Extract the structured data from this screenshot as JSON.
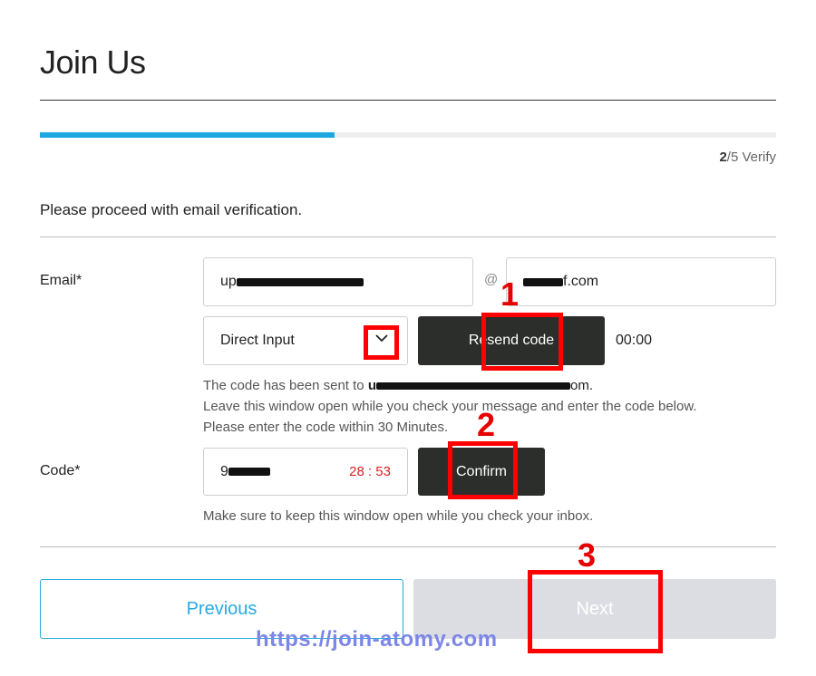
{
  "page": {
    "title": "Join Us",
    "progress_fraction": 0.4,
    "step_current": "2",
    "step_rest": "/5 Verify",
    "intro": "Please proceed with email verification."
  },
  "email": {
    "label": "Email*",
    "local_value": "up",
    "at": "@",
    "domain_prefix": "",
    "domain_suffix": "f.com",
    "domain_select": "Direct Input",
    "resend_label": "Resend code",
    "timer": "00:00",
    "sent_prefix": "The code has been sent to",
    "sent_email_start": "u",
    "sent_email_end": "om.",
    "help_line2": "Leave this window open while you check your message and enter the code below.",
    "help_line3": "Please enter the code within 30 Minutes."
  },
  "code": {
    "label": "Code*",
    "value_prefix": "9",
    "countdown": "28 : 53",
    "confirm_label": "Confirm",
    "help": "Make sure to keep this window open while you check your inbox."
  },
  "actions": {
    "previous_label": "Previous",
    "next_label": "Next"
  },
  "annotations": {
    "n1": "1",
    "n2": "2",
    "n3": "3"
  },
  "watermark": "https://join-atomy.com",
  "colors": {
    "accent_blue": "#1fa8e0",
    "countdown_red": "#d71f1f",
    "annotation_red": "#ff0000",
    "dark_button": "#2c2e2c",
    "disabled_button": "#dcdde3",
    "watermark": "#7c86e6"
  }
}
